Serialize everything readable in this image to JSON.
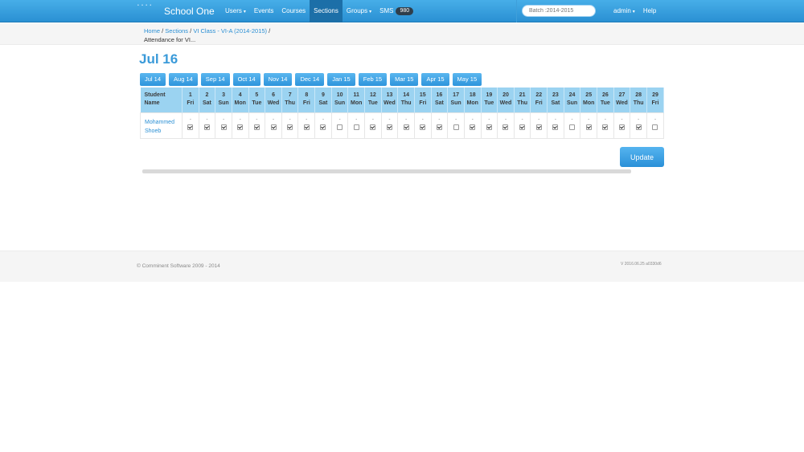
{
  "navbar": {
    "brand": "School One",
    "links": [
      {
        "label": "Users",
        "dropdown": true,
        "active": false
      },
      {
        "label": "Events",
        "dropdown": false,
        "active": false
      },
      {
        "label": "Courses",
        "dropdown": false,
        "active": false
      },
      {
        "label": "Sections",
        "dropdown": false,
        "active": true
      },
      {
        "label": "Groups",
        "dropdown": true,
        "active": false
      }
    ],
    "sms_label": "SMS",
    "sms_count": "980",
    "search_placeholder": "Batch :2014-2015",
    "admin_label": "admin",
    "help_label": "Help"
  },
  "breadcrumb": {
    "home": "Home",
    "sections": "Sections",
    "class": "VI Class - VI-A (2014-2015)",
    "current": "Attendance for VI..."
  },
  "page_title": "Jul 16",
  "month_tabs": [
    "Jul 14",
    "Aug 14",
    "Sep 14",
    "Oct 14",
    "Nov 14",
    "Dec 14",
    "Jan 15",
    "Feb 15",
    "Mar 15",
    "Apr 15",
    "May 15"
  ],
  "table": {
    "name_header_line1": "Student",
    "name_header_line2": "Name",
    "days": [
      {
        "d": "1",
        "w": "Fri"
      },
      {
        "d": "2",
        "w": "Sat"
      },
      {
        "d": "3",
        "w": "Sun"
      },
      {
        "d": "4",
        "w": "Mon"
      },
      {
        "d": "5",
        "w": "Tue"
      },
      {
        "d": "6",
        "w": "Wed"
      },
      {
        "d": "7",
        "w": "Thu"
      },
      {
        "d": "8",
        "w": "Fri"
      },
      {
        "d": "9",
        "w": "Sat"
      },
      {
        "d": "10",
        "w": "Sun"
      },
      {
        "d": "11",
        "w": "Mon"
      },
      {
        "d": "12",
        "w": "Tue"
      },
      {
        "d": "13",
        "w": "Wed"
      },
      {
        "d": "14",
        "w": "Thu"
      },
      {
        "d": "15",
        "w": "Fri"
      },
      {
        "d": "16",
        "w": "Sat"
      },
      {
        "d": "17",
        "w": "Sun"
      },
      {
        "d": "18",
        "w": "Mon"
      },
      {
        "d": "19",
        "w": "Tue"
      },
      {
        "d": "20",
        "w": "Wed"
      },
      {
        "d": "21",
        "w": "Thu"
      },
      {
        "d": "22",
        "w": "Fri"
      },
      {
        "d": "23",
        "w": "Sat"
      },
      {
        "d": "24",
        "w": "Sun"
      },
      {
        "d": "25",
        "w": "Mon"
      },
      {
        "d": "26",
        "w": "Tue"
      },
      {
        "d": "27",
        "w": "Wed"
      },
      {
        "d": "28",
        "w": "Thu"
      },
      {
        "d": "29",
        "w": "Fri"
      }
    ],
    "rows": [
      {
        "student_first": "Mohammed",
        "student_last": "Shoeb",
        "cell_mark": "-",
        "checks": [
          true,
          true,
          true,
          true,
          true,
          true,
          true,
          true,
          true,
          false,
          false,
          true,
          true,
          true,
          true,
          true,
          false,
          true,
          true,
          true,
          true,
          true,
          true,
          false,
          true,
          true,
          true,
          true,
          false
        ]
      }
    ]
  },
  "update_label": "Update",
  "footer": {
    "copyright": "© Comminent Software 2009 - 2014",
    "version": "V 2016.06.25 a0330d6"
  }
}
